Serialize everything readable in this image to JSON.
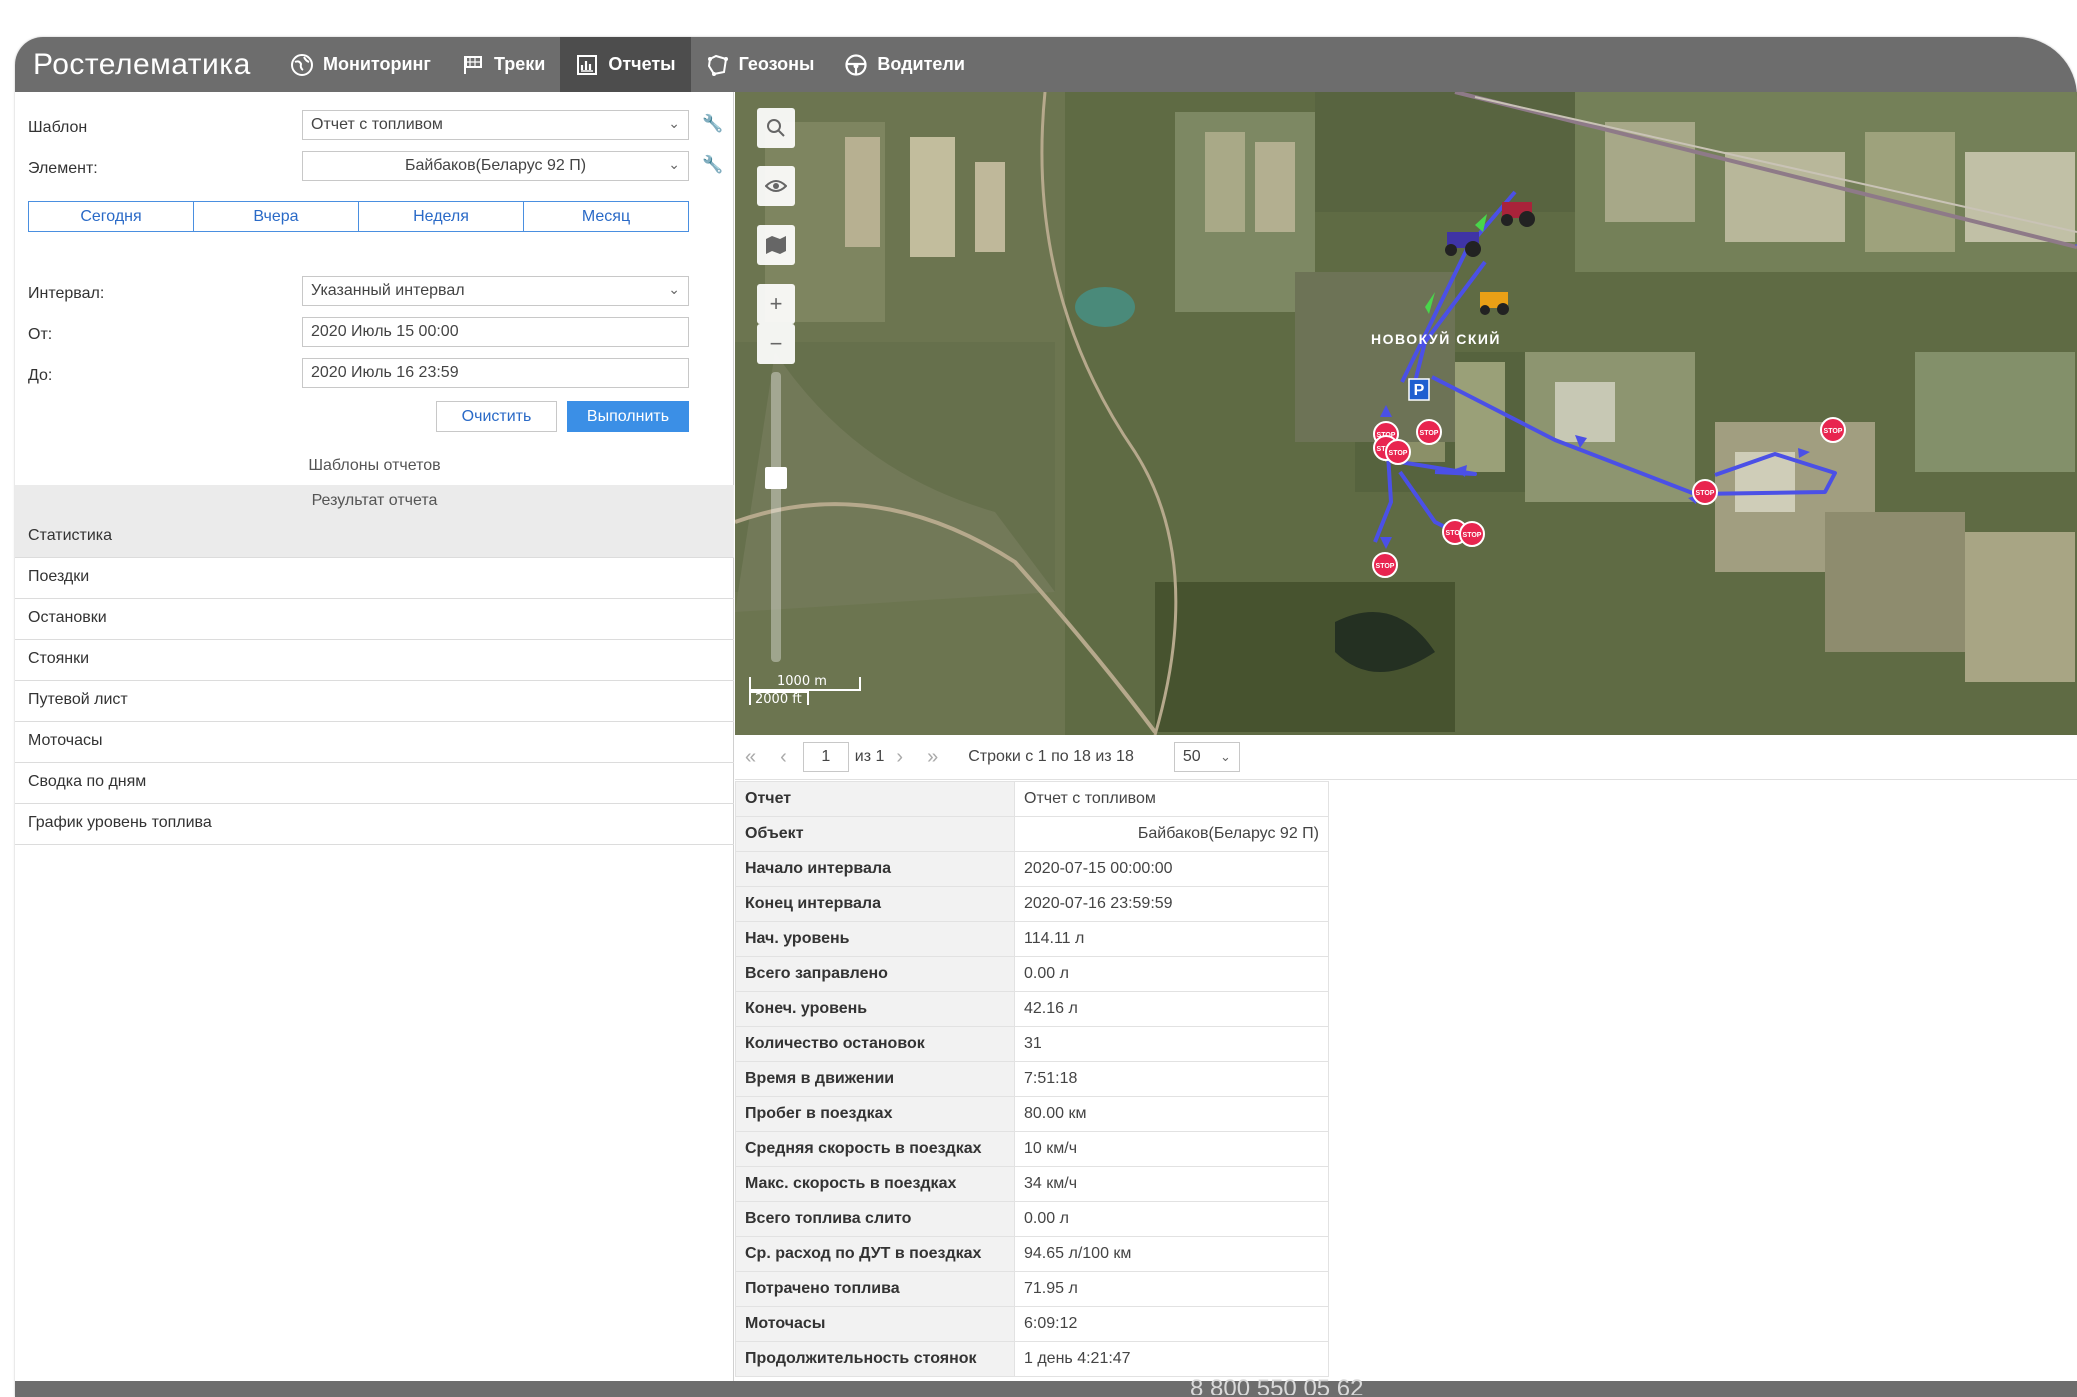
{
  "app": {
    "logo": "Ростелематика"
  },
  "nav": {
    "tabs": [
      {
        "label": "Мониторинг",
        "icon": "globe-icon"
      },
      {
        "label": "Треки",
        "icon": "flag-icon"
      },
      {
        "label": "Отчеты",
        "icon": "report-icon",
        "active": true
      },
      {
        "label": "Геозоны",
        "icon": "geofence-icon"
      },
      {
        "label": "Водители",
        "icon": "steering-wheel-icon"
      }
    ]
  },
  "form": {
    "template_label": "Шаблон",
    "template_value": "Отчет с топливом",
    "element_label": "Элемент:",
    "element_value": "Байбаков(Беларус 92 П)",
    "periods": [
      "Сегодня",
      "Вчера",
      "Неделя",
      "Месяц"
    ],
    "interval_label": "Интервал:",
    "interval_value": "Указанный интервал",
    "from_label": "От:",
    "from_value": "2020 Июль 15 00:00",
    "to_label": "До:",
    "to_value": "2020 Июль 16 23:59",
    "clear_label": "Очистить",
    "run_label": "Выполнить"
  },
  "templates_title": "Шаблоны отчетов",
  "result_title": "Результат отчета",
  "result_items": [
    "Статистика",
    "Поездки",
    "Остановки",
    "Стоянки",
    "Путевой лист",
    "Моточасы",
    "Сводка по дням",
    "График уровень топлива"
  ],
  "map": {
    "place_label": "НОВОКУЙ СКИЙ",
    "parking_label": "P",
    "stop_label": "STOP",
    "scale_m": "1000 m",
    "scale_ft": "2000 ft"
  },
  "pager": {
    "page": "1",
    "of_label": "из 1",
    "rows_label": "Строки с 1 по 18 из 18",
    "page_size": "50"
  },
  "report_table": [
    {
      "key": "Отчет",
      "value": "Отчет с топливом"
    },
    {
      "key": "Объект",
      "value": "Байбаков(Беларус 92 П)"
    },
    {
      "key": "Начало интервала",
      "value": "2020-07-15 00:00:00"
    },
    {
      "key": "Конец интервала",
      "value": "2020-07-16 23:59:59"
    },
    {
      "key": "Нач. уровень",
      "value": "114.11 л"
    },
    {
      "key": "Всего заправлено",
      "value": "0.00 л"
    },
    {
      "key": "Конеч. уровень",
      "value": "42.16 л"
    },
    {
      "key": "Количество остановок",
      "value": "31"
    },
    {
      "key": "Время в движении",
      "value": "7:51:18"
    },
    {
      "key": "Пробег в поездках",
      "value": "80.00 км"
    },
    {
      "key": "Средняя скорость в поездках",
      "value": "10 км/ч"
    },
    {
      "key": "Макс. скорость в поездках",
      "value": "34 км/ч"
    },
    {
      "key": "Всего топлива слито",
      "value": "0.00 л"
    },
    {
      "key": "Ср. расход по ДУТ в поездках",
      "value": "94.65 л/100 км"
    },
    {
      "key": "Потрачено топлива",
      "value": "71.95 л"
    },
    {
      "key": "Моточасы",
      "value": "6:09:12"
    },
    {
      "key": "Продолжительность стоянок",
      "value": "1 день 4:21:47"
    }
  ],
  "footer": {
    "phone": "8 800 550 05 62"
  },
  "colors": {
    "topbar": "#6d6d6d",
    "active_tab": "#4d4d4d",
    "primary": "#3b8fe6",
    "route": "#4b50e6",
    "stop": "#e8254f"
  }
}
